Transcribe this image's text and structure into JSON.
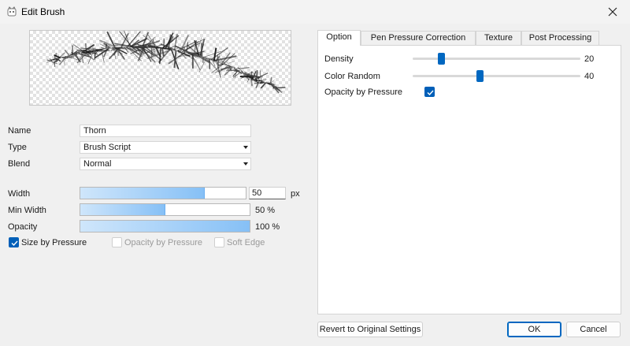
{
  "window": {
    "title": "Edit Brush"
  },
  "brush": {
    "name_label": "Name",
    "name_value": "Thorn",
    "type_label": "Type",
    "type_value": "Brush Script",
    "blend_label": "Blend",
    "blend_value": "Normal"
  },
  "params": {
    "width": {
      "label": "Width",
      "value": "50",
      "unit": "px",
      "fill": 0.75
    },
    "min_width": {
      "label": "Min Width",
      "value": "50 %",
      "fill": 0.5
    },
    "opacity": {
      "label": "Opacity",
      "value": "100 %",
      "fill": 1.0
    }
  },
  "checkboxes": {
    "size_by_pressure": {
      "label": "Size by Pressure",
      "checked": true,
      "enabled": true
    },
    "opacity_by_pressure": {
      "label": "Opacity by Pressure",
      "checked": false,
      "enabled": false
    },
    "soft_edge": {
      "label": "Soft Edge",
      "checked": false,
      "enabled": false
    }
  },
  "tabs": [
    {
      "label": "Option",
      "active": true
    },
    {
      "label": "Pen Pressure Correction",
      "active": false
    },
    {
      "label": "Texture",
      "active": false
    },
    {
      "label": "Post Processing",
      "active": false
    }
  ],
  "option": {
    "density": {
      "label": "Density",
      "value": "20",
      "position": 0.17
    },
    "color_random": {
      "label": "Color Random",
      "value": "40",
      "position": 0.4
    },
    "opacity_by_pressure": {
      "label": "Opacity by Pressure",
      "checked": true
    }
  },
  "buttons": {
    "revert": "Revert to Original Settings",
    "ok": "OK",
    "cancel": "Cancel"
  },
  "icons": {
    "app": "brush-app-icon",
    "close": "close-icon",
    "check": "checkmark-icon",
    "dropdown": "chevron-down-icon"
  },
  "colors": {
    "accent": "#005fb8",
    "bar_fill": "#86c0f6",
    "slider_thumb": "#0067c0"
  }
}
